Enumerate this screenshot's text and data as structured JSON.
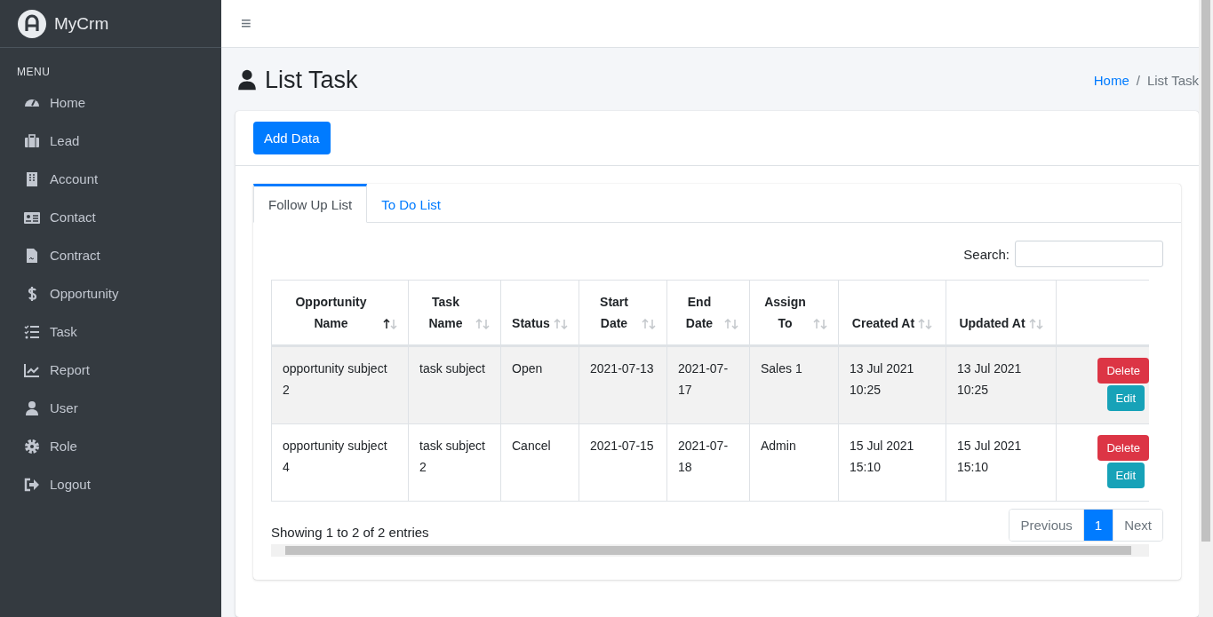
{
  "brand": {
    "name": "MyCrm"
  },
  "sidebar": {
    "header": "MENU",
    "items": [
      {
        "label": "Home"
      },
      {
        "label": "Lead"
      },
      {
        "label": "Account"
      },
      {
        "label": "Contact"
      },
      {
        "label": "Contract"
      },
      {
        "label": "Opportunity"
      },
      {
        "label": "Task"
      },
      {
        "label": "Report"
      },
      {
        "label": "User"
      },
      {
        "label": "Role"
      },
      {
        "label": "Logout"
      }
    ]
  },
  "navbar": {
    "menu_icon": "≡"
  },
  "page": {
    "title": "List Task",
    "breadcrumb_separator": "/",
    "breadcrumb": [
      {
        "label": "Home",
        "selected": false
      },
      {
        "label": "List Task",
        "selected": true
      }
    ]
  },
  "add_button": "Add Data",
  "tabs": [
    {
      "label": "Follow Up List",
      "selected": true
    },
    {
      "label": "To Do List",
      "selected": false
    }
  ],
  "search": {
    "label": "Search:"
  },
  "table": {
    "columns": [
      {
        "label": "Opportunity Name",
        "sorted": true
      },
      {
        "label": "Task Name",
        "sorted": false
      },
      {
        "label": "Status",
        "sorted": false
      },
      {
        "label": "Start Date",
        "sorted": false
      },
      {
        "label": "End Date",
        "sorted": false
      },
      {
        "label": "Assign To",
        "sorted": false
      },
      {
        "label": "Created At",
        "sorted": false
      },
      {
        "label": "Updated At",
        "sorted": false
      }
    ],
    "rows": [
      {
        "cells": [
          "opportunity subject 2",
          "task subject",
          "Open",
          "2021-07-13",
          "2021-07-17",
          "Sales 1",
          "13 Jul 2021 10:25",
          "13 Jul 2021 10:25"
        ],
        "actions": [
          "Delete",
          "Edit"
        ]
      },
      {
        "cells": [
          "opportunity subject 4",
          "task subject 2",
          "Cancel",
          "2021-07-15",
          "2021-07-18",
          "Admin",
          "15 Jul 2021 15:10",
          "15 Jul 2021 15:10"
        ],
        "actions": [
          "Delete",
          "Edit"
        ]
      }
    ]
  },
  "info": "Showing 1 to 2 of 2 entries",
  "pagination": [
    {
      "label": "Previous",
      "selected": false,
      "disabled": true
    },
    {
      "label": "1",
      "selected": true,
      "disabled": false
    },
    {
      "label": "Next",
      "selected": false,
      "disabled": true
    }
  ]
}
